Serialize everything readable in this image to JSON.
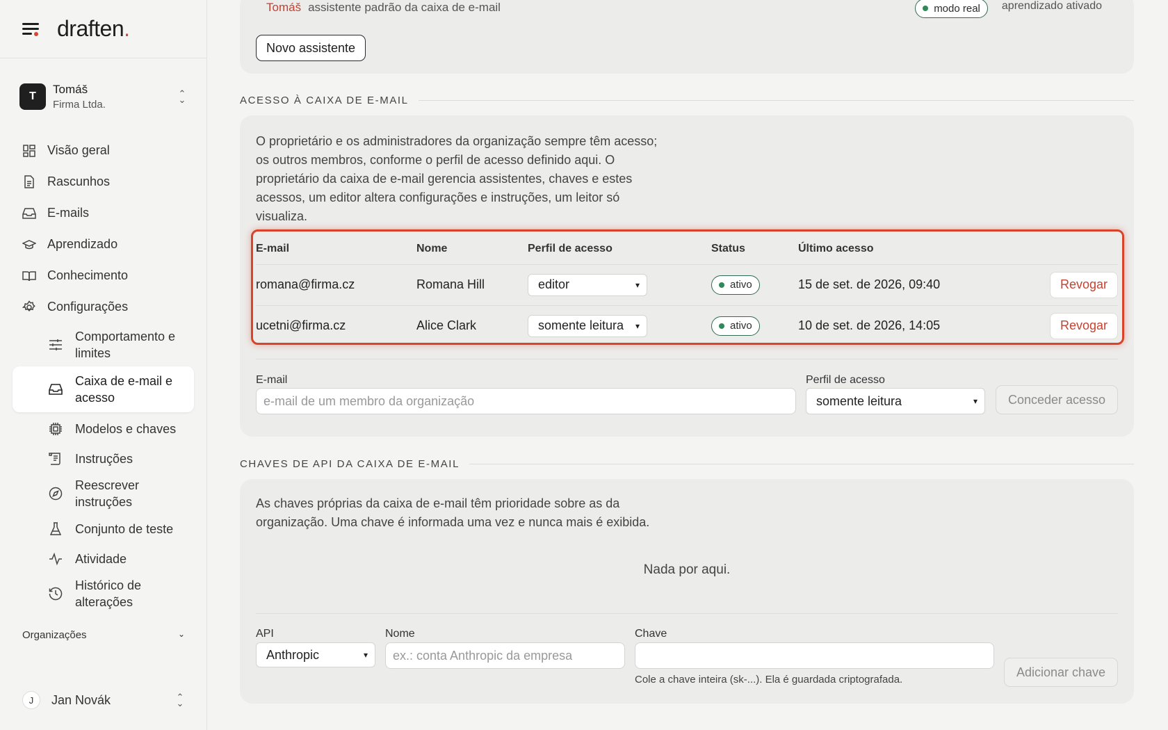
{
  "brand": {
    "name": "draften",
    "dot": "."
  },
  "account": {
    "initial": "T",
    "name": "Tomáš",
    "org": "Firma Ltda."
  },
  "nav": {
    "items": [
      {
        "label": "Visão geral",
        "icon": "grid-icon"
      },
      {
        "label": "Rascunhos",
        "icon": "document-icon"
      },
      {
        "label": "E-mails",
        "icon": "inbox-icon"
      },
      {
        "label": "Aprendizado",
        "icon": "graduation-cap-icon"
      },
      {
        "label": "Conhecimento",
        "icon": "book-icon"
      },
      {
        "label": "Configurações",
        "icon": "gear-icon"
      }
    ],
    "sub_items": [
      {
        "label": "Comportamento e limites",
        "icon": "sliders-icon"
      },
      {
        "label": "Caixa de e-mail e acesso",
        "icon": "inbox-icon",
        "active": true
      },
      {
        "label": "Modelos e chaves",
        "icon": "chip-icon"
      },
      {
        "label": "Instruções",
        "icon": "scroll-icon"
      },
      {
        "label": "Reescrever instruções",
        "icon": "compass-icon"
      },
      {
        "label": "Conjunto de teste",
        "icon": "flask-icon"
      },
      {
        "label": "Atividade",
        "icon": "activity-icon"
      },
      {
        "label": "Histórico de alterações",
        "icon": "history-icon"
      }
    ]
  },
  "orgs_label": "Organizações",
  "user": {
    "initial": "J",
    "name": "Jan Novák"
  },
  "assistant_row": {
    "owner": "Tomáš",
    "description": "assistente padrão da caixa de e-mail",
    "mode": "modo real",
    "learning": "aprendizado ativado",
    "new_button": "Novo assistente"
  },
  "access_section": {
    "title": "ACESSO À CAIXA DE E-MAIL",
    "description": "O proprietário e os administradores da organização sempre têm acesso; os outros membros, conforme o perfil de acesso definido aqui. O proprietário da caixa de e-mail gerencia assistentes, chaves e estes acessos, um editor altera configurações e instruções, um leitor só visualiza.",
    "columns": [
      "E-mail",
      "Nome",
      "Perfil de acesso",
      "Status",
      "Último acesso"
    ],
    "rows": [
      {
        "email": "romana@firma.cz",
        "name": "Romana Hill",
        "role": "editor",
        "status": "ativo",
        "last": "15 de set. de 2026, 09:40",
        "action": "Revogar"
      },
      {
        "email": "ucetni@firma.cz",
        "name": "Alice Clark",
        "role": "somente leitura",
        "status": "ativo",
        "last": "10 de set. de 2026, 14:05",
        "action": "Revogar"
      }
    ],
    "form": {
      "email_label": "E-mail",
      "email_placeholder": "e-mail de um membro da organização",
      "role_label": "Perfil de acesso",
      "role_value": "somente leitura",
      "grant_button": "Conceder acesso"
    }
  },
  "keys_section": {
    "title": "CHAVES DE API DA CAIXA DE E-MAIL",
    "description": "As chaves próprias da caixa de e-mail têm prioridade sobre as da organização. Uma chave é informada uma vez e nunca mais é exibida.",
    "empty": "Nada por aqui.",
    "form": {
      "api_label": "API",
      "api_value": "Anthropic",
      "name_label": "Nome",
      "name_placeholder": "ex.: conta Anthropic da empresa",
      "key_label": "Chave",
      "key_hint": "Cole a chave inteira (sk-...). Ela é guardada criptografada.",
      "add_button": "Adicionar chave"
    }
  },
  "colors": {
    "accent_red": "#d8432c",
    "active_green": "#2f8a57"
  }
}
